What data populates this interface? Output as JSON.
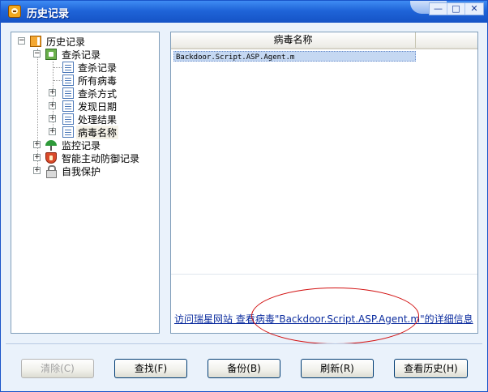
{
  "window": {
    "title": "历史记录"
  },
  "tree": {
    "root": "历史记录",
    "scan": "查杀记录",
    "scan_children": [
      "查杀记录",
      "所有病毒",
      "查杀方式",
      "发现日期",
      "处理结果",
      "病毒名称"
    ],
    "monitor": "监控记录",
    "defense": "智能主动防御记录",
    "self_protect": "自我保护"
  },
  "list": {
    "column_header": "病毒名称",
    "rows": [
      "Backdoor.Script.ASP.Agent.m"
    ],
    "info_link": "访问瑞星网站 查看病毒\"Backdoor.Script.ASP.Agent.m\"的详细信息"
  },
  "buttons": {
    "clear": "清除(C)",
    "find": "查找(F)",
    "backup": "备份(B)",
    "refresh": "刷新(R)",
    "history": "查看历史(H)"
  },
  "icons": {
    "root": "history-book-icon",
    "scan": "scan-record-icon",
    "leaf": "page-icon",
    "monitor": "umbrella-icon",
    "defense": "shield-icon",
    "self_protect": "lock-icon"
  },
  "colors": {
    "titlebar": "#1f64d8",
    "selection": "#c5d8f2",
    "link": "#0c2d9f",
    "annotation": "#d21010"
  }
}
